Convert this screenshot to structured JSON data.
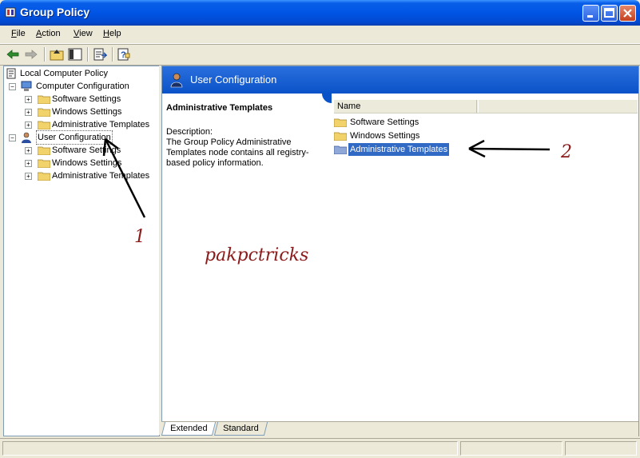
{
  "window": {
    "title": "Group Policy"
  },
  "menu": {
    "items": [
      "File",
      "Action",
      "View",
      "Help"
    ]
  },
  "tree": {
    "root": "Local Computer Policy",
    "computer_config": "Computer Configuration",
    "computer_children": [
      "Software Settings",
      "Windows Settings",
      "Administrative Templates"
    ],
    "user_config": "User Configuration",
    "user_children": [
      "Software Settings",
      "Windows Settings",
      "Administrative Templates"
    ]
  },
  "detail": {
    "header_title": "User Configuration",
    "selected_heading": "Administrative Templates",
    "description_label": "Description:",
    "description_text": "The Group Policy Administrative Templates node contains all registry-based policy information."
  },
  "list": {
    "column_name": "Name",
    "items": [
      "Software Settings",
      "Windows Settings",
      "Administrative Templates"
    ],
    "selected_index": 2
  },
  "tabs": {
    "extended": "Extended",
    "standard": "Standard"
  },
  "annotations": {
    "label_1": "1",
    "label_2": "2",
    "watermark": "pakpctricks"
  },
  "colors": {
    "titlebar": "#0055e5",
    "selection": "#316ac5",
    "annotation": "#8b1a1a",
    "folder": "#f2d36b"
  }
}
